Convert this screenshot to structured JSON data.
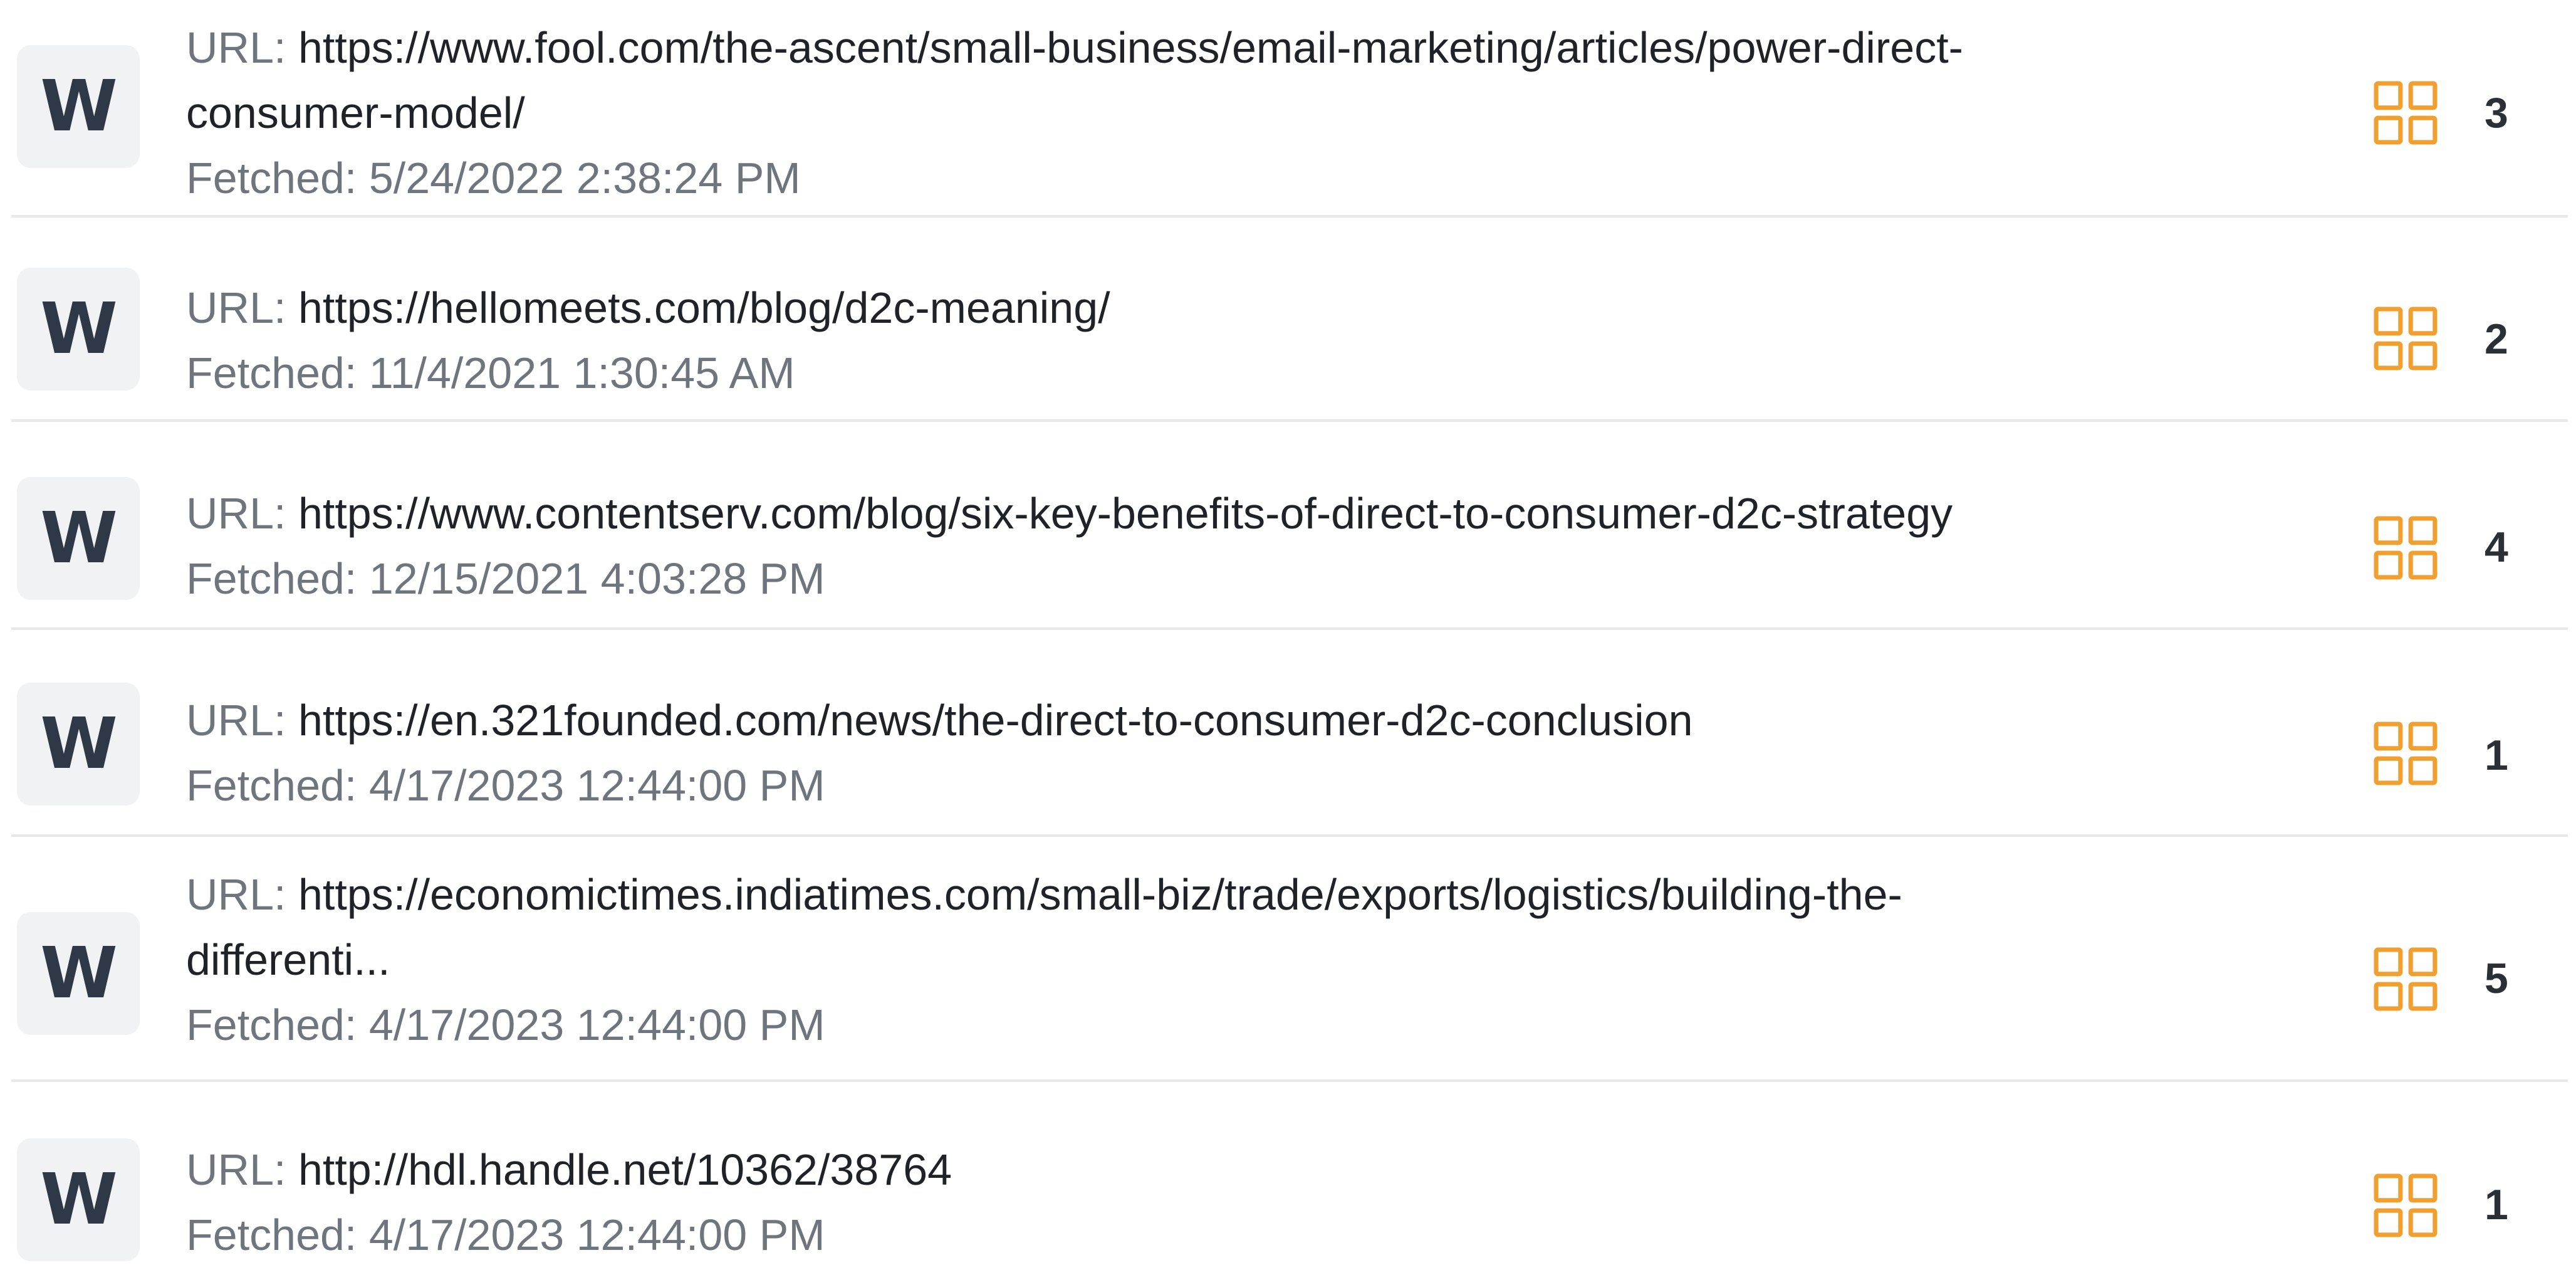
{
  "source_list": {
    "url_label": "URL:",
    "fetched_label": "Fetched:",
    "accent_color": "#f0a030",
    "items": [
      {
        "source_letter": "W",
        "url_lines": [
          "https://www.fool.com/the-ascent/small-business/email-marketing/articles/power-direct-",
          "consumer-model/"
        ],
        "fetched": "5/24/2022 2:38:24 PM",
        "match_count": "3",
        "icon": "grid-icon"
      },
      {
        "source_letter": "W",
        "url_lines": [
          "https://hellomeets.com/blog/d2c-meaning/"
        ],
        "fetched": "11/4/2021 1:30:45 AM",
        "match_count": "2",
        "icon": "grid-icon"
      },
      {
        "source_letter": "W",
        "url_lines": [
          "https://www.contentserv.com/blog/six-key-benefits-of-direct-to-consumer-d2c-strategy"
        ],
        "fetched": "12/15/2021 4:03:28 PM",
        "match_count": "4",
        "icon": "grid-icon"
      },
      {
        "source_letter": "W",
        "url_lines": [
          "https://en.321founded.com/news/the-direct-to-consumer-d2c-conclusion"
        ],
        "fetched": "4/17/2023 12:44:00 PM",
        "match_count": "1",
        "icon": "grid-icon"
      },
      {
        "source_letter": "W",
        "url_lines": [
          "https://economictimes.indiatimes.com/small-biz/trade/exports/logistics/building-the-",
          "differenti..."
        ],
        "fetched": "4/17/2023 12:44:00 PM",
        "match_count": "5",
        "icon": "grid-icon"
      },
      {
        "source_letter": "W",
        "url_lines": [
          "http://hdl.handle.net/10362/38764"
        ],
        "fetched": "4/17/2023 12:44:00 PM",
        "match_count": "1",
        "icon": "grid-icon"
      }
    ]
  }
}
